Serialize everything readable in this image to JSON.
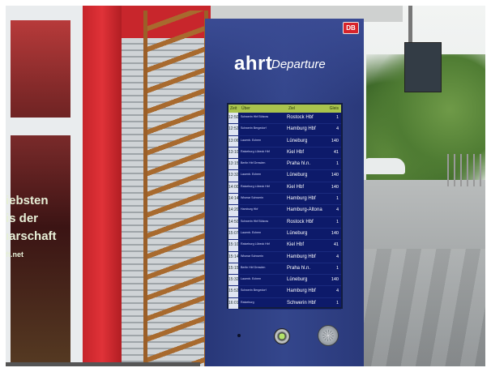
{
  "kiosk": {
    "logo_badge": "DB",
    "brand": "ahrt",
    "subtitle": "Departure"
  },
  "board": {
    "headers": {
      "zeit": "Zeit",
      "ueber": "Über",
      "ziel": "Ziel",
      "gleis": "Gleis"
    },
    "rows": [
      {
        "time": "12:50",
        "via": "Schwerin Hbf Bützow",
        "destination": "Rostock Hbf",
        "track": "1"
      },
      {
        "time": "12:52",
        "via": "Schwerin Bergedorf",
        "destination": "Hamburg Hbf",
        "track": "4"
      },
      {
        "time": "13:06",
        "via": "Lauenb. Echem",
        "destination": "Lüneburg",
        "track": "140"
      },
      {
        "time": "13:10",
        "via": "Ratzeburg Lübeck Hbf",
        "destination": "Kiel Hbf",
        "track": "41"
      },
      {
        "time": "13:15",
        "via": "Berlin Hbf Dresden",
        "destination": "Praha hl.n.",
        "track": "1"
      },
      {
        "time": "13:32",
        "via": "Lauenb. Echem",
        "destination": "Lüneburg",
        "track": "140"
      },
      {
        "time": "14:00",
        "via": "Ratzeburg Lübeck Hbf",
        "destination": "Kiel Hbf",
        "track": "140"
      },
      {
        "time": "14:14",
        "via": "Wismar Schwerin",
        "destination": "Hamburg Hbf",
        "track": "1"
      },
      {
        "time": "14:20",
        "via": "Hamburg Hbf",
        "destination": "Hamburg-Altona",
        "track": "4"
      },
      {
        "time": "14:50",
        "via": "Schwerin Hbf Bützow",
        "destination": "Rostock Hbf",
        "track": "1"
      },
      {
        "time": "15:07",
        "via": "Lauenb. Echem",
        "destination": "Lüneburg",
        "track": "140"
      },
      {
        "time": "15:10",
        "via": "Ratzeburg Lübeck Hbf",
        "destination": "Kiel Hbf",
        "track": "41"
      },
      {
        "time": "15:14",
        "via": "Wismar Schwerin",
        "destination": "Hamburg Hbf",
        "track": "4"
      },
      {
        "time": "15:15",
        "via": "Berlin Hbf Dresden",
        "destination": "Praha hl.n.",
        "track": "1"
      },
      {
        "time": "15:32",
        "via": "Lauenb. Echem",
        "destination": "Lüneburg",
        "track": "140"
      },
      {
        "time": "15:52",
        "via": "Schwerin Bergedorf",
        "destination": "Hamburg Hbf",
        "track": "4"
      },
      {
        "time": "16:01",
        "via": "Ratzeburg",
        "destination": "Schwerin Hbf",
        "track": "1"
      }
    ]
  },
  "shop_window": {
    "line1": "iebsten",
    "line2": "is der",
    "line3": "ıarschaft",
    "line4": "ft.net"
  }
}
